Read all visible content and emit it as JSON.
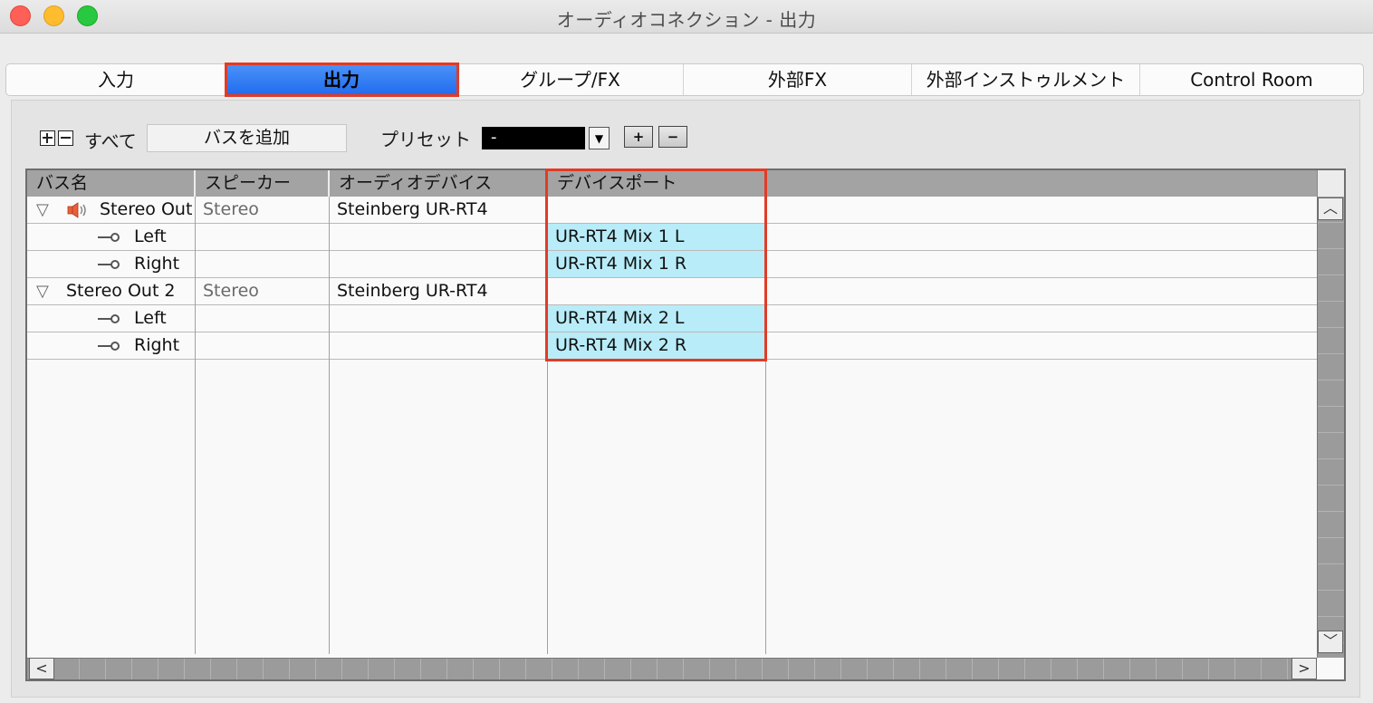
{
  "window": {
    "title": "オーディオコネクション - 出力"
  },
  "tabs": [
    {
      "label": "入力",
      "active": false
    },
    {
      "label": "出力",
      "active": true
    },
    {
      "label": "グループ/FX",
      "active": false
    },
    {
      "label": "外部FX",
      "active": false
    },
    {
      "label": "外部インストゥルメント",
      "active": false
    },
    {
      "label": "Control Room",
      "active": false
    }
  ],
  "toolbar": {
    "all_label": "すべて",
    "add_bus_label": "バスを追加",
    "preset_label": "プリセット",
    "preset_value": "-",
    "preset_dropdown_glyph": "▼",
    "preset_store_glyph": "+",
    "preset_remove_glyph": "−"
  },
  "table": {
    "headers": [
      "バス名",
      "スピーカー",
      "オーディオデバイス",
      "デバイスポート"
    ],
    "rows": [
      {
        "kind": "bus",
        "name": "Stereo Out",
        "speaker": "Stereo",
        "device": "Steinberg UR-RT4",
        "port": "",
        "icon": "speaker-icon"
      },
      {
        "kind": "channel",
        "name": "Left",
        "speaker": "",
        "device": "",
        "port": "UR-RT4 Mix 1 L"
      },
      {
        "kind": "channel",
        "name": "Right",
        "speaker": "",
        "device": "",
        "port": "UR-RT4 Mix 1 R"
      },
      {
        "kind": "bus",
        "name": "Stereo Out 2",
        "speaker": "Stereo",
        "device": "Steinberg UR-RT4",
        "port": ""
      },
      {
        "kind": "channel",
        "name": "Left",
        "speaker": "",
        "device": "",
        "port": "UR-RT4 Mix 2 L"
      },
      {
        "kind": "channel",
        "name": "Right",
        "speaker": "",
        "device": "",
        "port": "UR-RT4 Mix 2 R"
      }
    ]
  },
  "scrollbars": {
    "up_glyph": "︿",
    "down_glyph": "﹀",
    "left_glyph": "<",
    "right_glyph": ">"
  },
  "colors": {
    "active_tab": "#1f6cf0",
    "highlight": "#e23b25",
    "port_cell": "#b8ecf8"
  }
}
